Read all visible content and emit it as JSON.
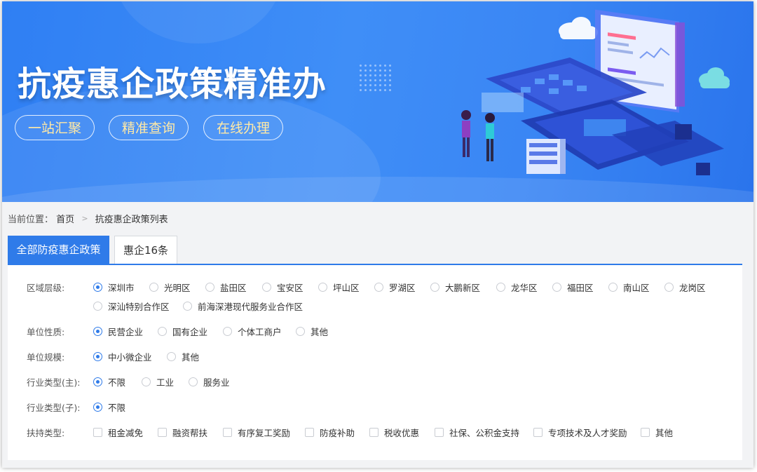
{
  "banner": {
    "title": "抗疫惠企政策精准办",
    "pills": [
      "一站汇聚",
      "精准查询",
      "在线办理"
    ]
  },
  "breadcrumb": {
    "prefix": "当前位置：",
    "home": "首页",
    "current": "抗疫惠企政策列表"
  },
  "tabs": [
    {
      "label": "全部防疫惠企政策",
      "active": true
    },
    {
      "label": "惠企16条",
      "active": false
    }
  ],
  "filters": {
    "region": {
      "label": "区域层级:",
      "selected": "深圳市",
      "options": [
        "深圳市",
        "光明区",
        "盐田区",
        "宝安区",
        "坪山区",
        "罗湖区",
        "大鹏新区",
        "龙华区",
        "福田区",
        "南山区",
        "龙岗区",
        "深汕特别合作区",
        "前海深港现代服务业合作区"
      ]
    },
    "nature": {
      "label": "单位性质:",
      "selected": "民营企业",
      "options": [
        "民营企业",
        "国有企业",
        "个体工商户",
        "其他"
      ]
    },
    "scale": {
      "label": "单位规模:",
      "selected": "中小微企业",
      "options": [
        "中小微企业",
        "其他"
      ]
    },
    "industry_main": {
      "label": "行业类型(主):",
      "selected": "不限",
      "options": [
        "不限",
        "工业",
        "服务业"
      ]
    },
    "industry_sub": {
      "label": "行业类型(子):",
      "selected": "不限",
      "options": [
        "不限"
      ]
    },
    "support": {
      "label": "扶持类型:",
      "options": [
        "租金减免",
        "融资帮扶",
        "有序复工奖励",
        "防疫补助",
        "税收优惠",
        "社保、公积金支持",
        "专项技术及人才奖励",
        "其他"
      ]
    }
  },
  "colors": {
    "accent": "#2f7be9",
    "pill_text": "#ffe9a6",
    "banner_bg": "#3a86f4"
  }
}
